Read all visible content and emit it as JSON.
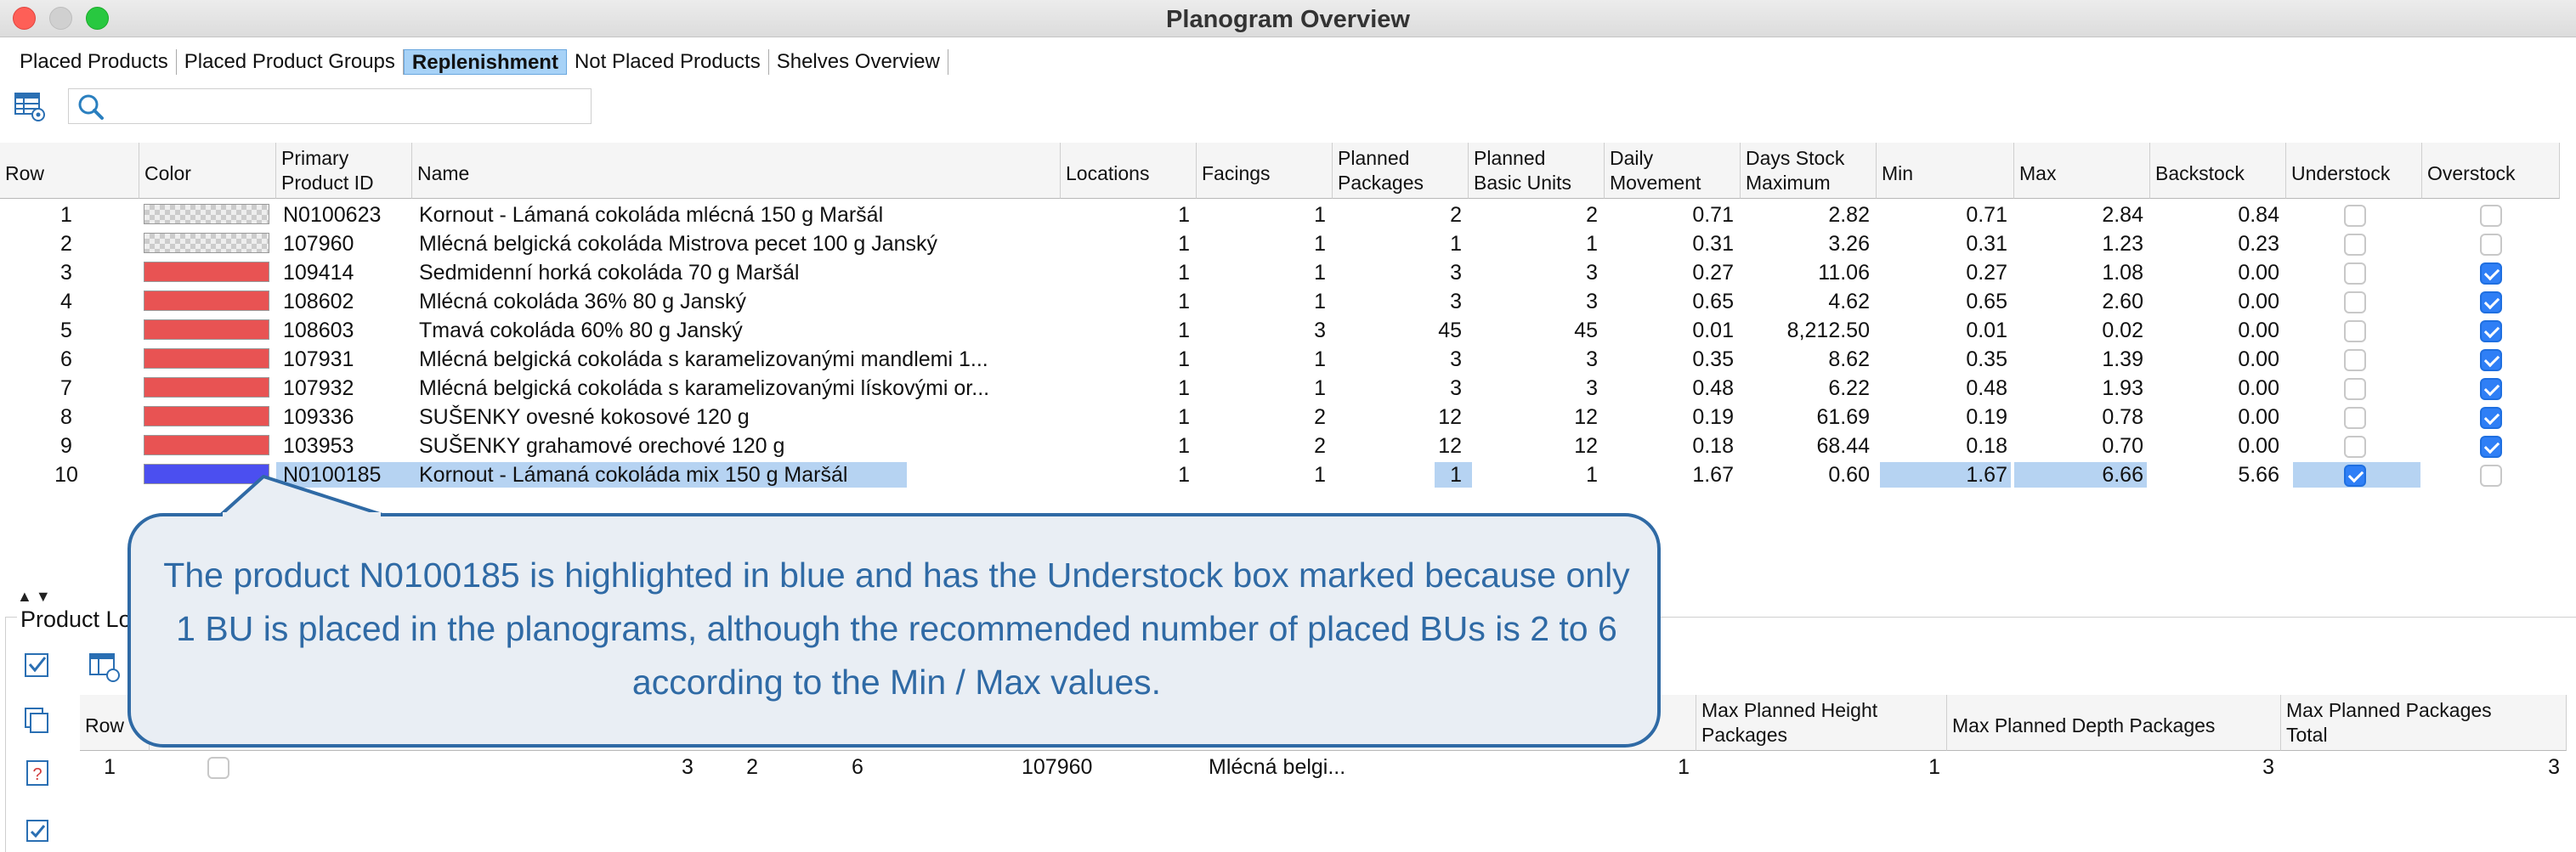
{
  "window": {
    "title": "Planogram Overview"
  },
  "tabs": [
    "Placed Products",
    "Placed Product Groups",
    "Replenishment",
    "Not Placed Products",
    "Shelves Overview"
  ],
  "active_tab": "Replenishment",
  "search": {
    "value": "",
    "placeholder": ""
  },
  "table": {
    "headers": {
      "row": "Row",
      "color": "Color",
      "sort_index": "1",
      "pid1": "Primary",
      "pid2": "Product ID",
      "name": "Name",
      "locations": "Locations",
      "facings": "Facings",
      "pp1": "Planned",
      "pp2": "Packages",
      "pbu1": "Planned",
      "pbu2": "Basic Units",
      "dm1": "Daily",
      "dm2": "Movement",
      "dsm1": "Days Stock",
      "dsm2": "Maximum",
      "min": "Min",
      "max": "Max",
      "backstock": "Backstock",
      "understock": "Understock",
      "overstock": "Overstock"
    },
    "rows": [
      {
        "row": "1",
        "color": "checker",
        "pid": "N0100623",
        "name": "Kornout - Lámaná cokoláda mlécná 150 g Maršál",
        "locations": "1",
        "facings": "1",
        "pp": "2",
        "pbu": "2",
        "dm": "0.71",
        "dsm": "2.82",
        "min": "0.71",
        "max": "2.84",
        "backstock": "0.84",
        "understock": false,
        "overstock": false
      },
      {
        "row": "2",
        "color": "checker",
        "pid": "107960",
        "name": "Mlécná belgická cokoláda Mistrova pecet 100 g Janský",
        "locations": "1",
        "facings": "1",
        "pp": "1",
        "pbu": "1",
        "dm": "0.31",
        "dsm": "3.26",
        "min": "0.31",
        "max": "1.23",
        "backstock": "0.23",
        "understock": false,
        "overstock": false
      },
      {
        "row": "3",
        "color": "red",
        "pid": "109414",
        "name": "Sedmidenní horká cokoláda 70 g Maršál",
        "locations": "1",
        "facings": "1",
        "pp": "3",
        "pbu": "3",
        "dm": "0.27",
        "dsm": "11.06",
        "min": "0.27",
        "max": "1.08",
        "backstock": "0.00",
        "understock": false,
        "overstock": true
      },
      {
        "row": "4",
        "color": "red",
        "pid": "108602",
        "name": "Mlécná cokoláda 36% 80 g Janský",
        "locations": "1",
        "facings": "1",
        "pp": "3",
        "pbu": "3",
        "dm": "0.65",
        "dsm": "4.62",
        "min": "0.65",
        "max": "2.60",
        "backstock": "0.00",
        "understock": false,
        "overstock": true
      },
      {
        "row": "5",
        "color": "red",
        "pid": "108603",
        "name": "Tmavá cokoláda 60% 80 g Janský",
        "locations": "1",
        "facings": "3",
        "pp": "45",
        "pbu": "45",
        "dm": "0.01",
        "dsm": "8,212.50",
        "min": "0.01",
        "max": "0.02",
        "backstock": "0.00",
        "understock": false,
        "overstock": true
      },
      {
        "row": "6",
        "color": "red",
        "pid": "107931",
        "name": "Mlécná belgická cokoláda s karamelizovanými mandlemi 1...",
        "locations": "1",
        "facings": "1",
        "pp": "3",
        "pbu": "3",
        "dm": "0.35",
        "dsm": "8.62",
        "min": "0.35",
        "max": "1.39",
        "backstock": "0.00",
        "understock": false,
        "overstock": true
      },
      {
        "row": "7",
        "color": "red",
        "pid": "107932",
        "name": "Mlécná belgická cokoláda s karamelizovanými lískovými or...",
        "locations": "1",
        "facings": "1",
        "pp": "3",
        "pbu": "3",
        "dm": "0.48",
        "dsm": "6.22",
        "min": "0.48",
        "max": "1.93",
        "backstock": "0.00",
        "understock": false,
        "overstock": true
      },
      {
        "row": "8",
        "color": "red",
        "pid": "109336",
        "name": "SUŠENKY ovesné kokosové 120 g",
        "locations": "1",
        "facings": "2",
        "pp": "12",
        "pbu": "12",
        "dm": "0.19",
        "dsm": "61.69",
        "min": "0.19",
        "max": "0.78",
        "backstock": "0.00",
        "understock": false,
        "overstock": true
      },
      {
        "row": "9",
        "color": "red",
        "pid": "103953",
        "name": "SUŠENKY grahamové orechové 120 g",
        "locations": "1",
        "facings": "2",
        "pp": "12",
        "pbu": "12",
        "dm": "0.18",
        "dsm": "68.44",
        "min": "0.18",
        "max": "0.70",
        "backstock": "0.00",
        "understock": false,
        "overstock": true
      },
      {
        "row": "10",
        "color": "blue",
        "pid": "N0100185",
        "name": "Kornout - Lámaná cokoláda mix 150 g Maršál",
        "locations": "1",
        "facings": "1",
        "pp": "1",
        "pbu": "1",
        "dm": "1.67",
        "dsm": "0.60",
        "min": "1.67",
        "max": "6.66",
        "backstock": "5.66",
        "understock": true,
        "overstock": false
      }
    ]
  },
  "bottom_panel": {
    "label": "Product Lo",
    "headers": {
      "row": "Row",
      "mph1": "Max Planned Height",
      "mph2": "Packages",
      "mpd": "Max Planned Depth Packages",
      "mpt1": "Max Planned Packages",
      "mpt2": "Total"
    },
    "row": {
      "row": "1",
      "c1": "2",
      "c2": "3",
      "c3": "6",
      "pid": "107960",
      "name": "Mlécná belgi...",
      "c4": "1",
      "mph": "1",
      "mpd": "3",
      "mpt": "3"
    }
  },
  "callout": {
    "text": "The product N0100185 is highlighted in blue and has the Understock box marked because only 1 BU is placed in the planograms, although the recommended number of placed BUs is 2 to 6 according to the Min / Max values."
  },
  "colors": {
    "red_swatch": "#e85353",
    "blue_swatch": "#4b4ff0",
    "selection": "#b6d3f2",
    "callout_border": "#2f6aa5",
    "callout_fill": "#e9eef4",
    "checkbox_on": "#2f7ff6"
  }
}
